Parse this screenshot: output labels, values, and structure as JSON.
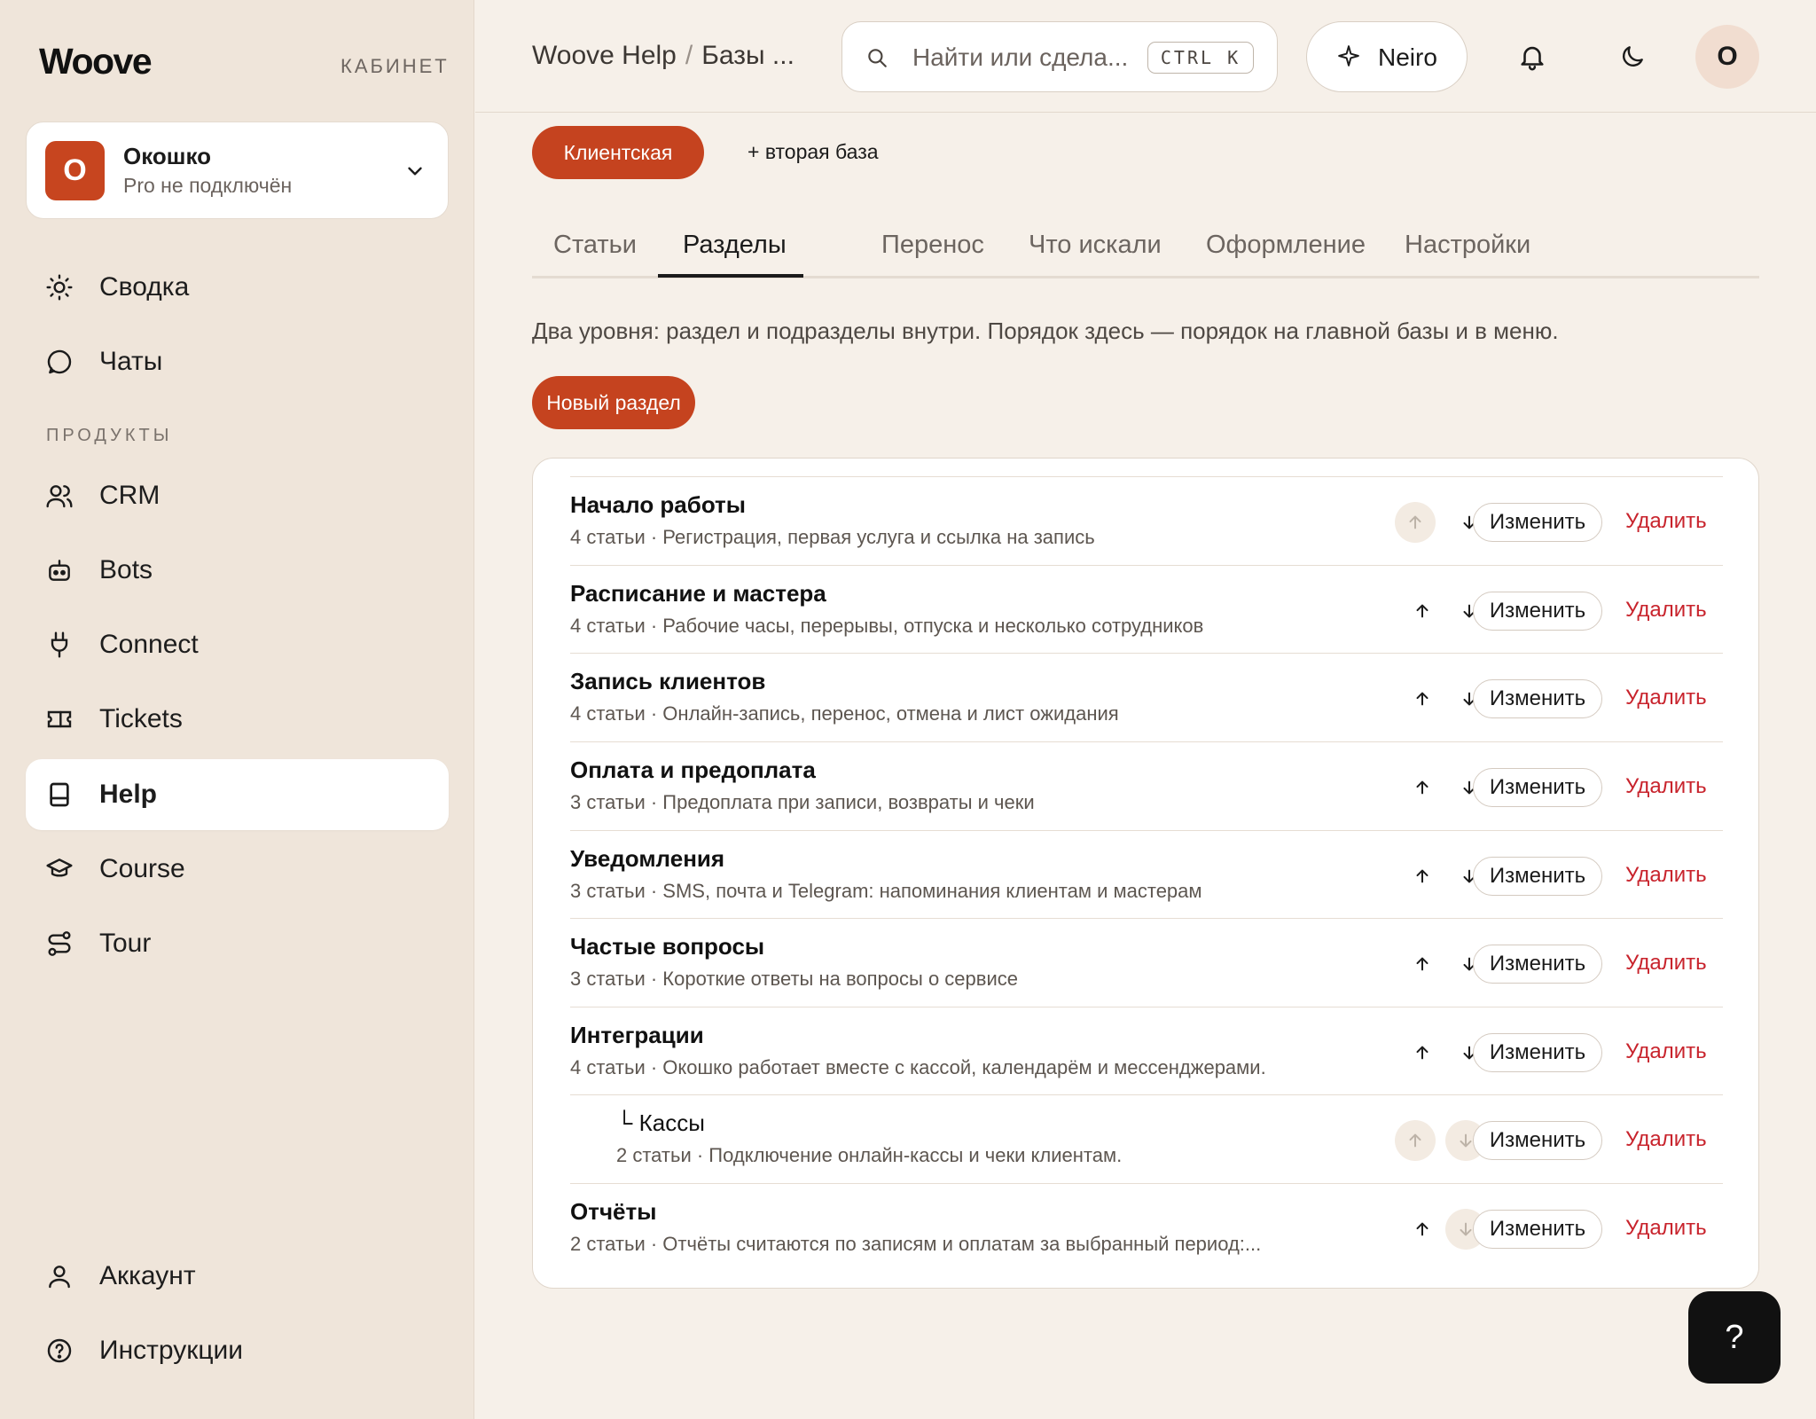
{
  "sidebar": {
    "logo": "Woove",
    "cabinet_label": "КАБИНЕТ",
    "org": {
      "initial": "О",
      "name": "Окошко",
      "plan": "Pro не подключён"
    },
    "nav_top": [
      {
        "label": "Сводка",
        "icon": "sun-icon"
      },
      {
        "label": "Чаты",
        "icon": "chat-icon"
      }
    ],
    "products_label": "ПРОДУКТЫ",
    "products": [
      {
        "label": "CRM",
        "icon": "users-icon"
      },
      {
        "label": "Bots",
        "icon": "bot-icon"
      },
      {
        "label": "Connect",
        "icon": "plug-icon"
      },
      {
        "label": "Tickets",
        "icon": "ticket-icon"
      },
      {
        "label": "Help",
        "icon": "book-icon",
        "active": true
      },
      {
        "label": "Course",
        "icon": "graduation-cap-icon"
      },
      {
        "label": "Tour",
        "icon": "route-icon"
      }
    ],
    "nav_bottom": [
      {
        "label": "Аккаунт",
        "icon": "user-icon"
      },
      {
        "label": "Инструкции",
        "icon": "help-circle-icon"
      }
    ]
  },
  "header": {
    "breadcrumb": [
      "Woove Help",
      "Базы ..."
    ],
    "search_placeholder": "Найти или сдела...",
    "search_shortcut": "CTRL K",
    "neiro_label": "Neiro",
    "avatar_initial": "О"
  },
  "bases": {
    "active": "Клиентская",
    "add_label": "+ вторая база"
  },
  "tabs": [
    "Статьи",
    "Разделы",
    "Перенос",
    "Что искали",
    "Оформление",
    "Настройки"
  ],
  "active_tab": "Разделы",
  "description": "Два уровня: раздел и подразделы внутри. Порядок здесь — порядок на главной базы и в меню.",
  "new_section_label": "Новый раздел",
  "sections": [
    {
      "title": "Начало работы",
      "meta": "4 статьи · Регистрация, первая услуга и ссылка на запись",
      "up": false,
      "down": true
    },
    {
      "title": "Расписание и мастера",
      "meta": "4 статьи · Рабочие часы, перерывы, отпуска и несколько сотрудников",
      "up": true,
      "down": true
    },
    {
      "title": "Запись клиентов",
      "meta": "4 статьи · Онлайн-запись, перенос, отмена и лист ожидания",
      "up": true,
      "down": true
    },
    {
      "title": "Оплата и предоплата",
      "meta": "3 статьи · Предоплата при записи, возвраты и чеки",
      "up": true,
      "down": true
    },
    {
      "title": "Уведомления",
      "meta": "3 статьи · SMS, почта и Telegram: напоминания клиентам и мастерам",
      "up": true,
      "down": true
    },
    {
      "title": "Частые вопросы",
      "meta": "3 статьи · Короткие ответы на вопросы о сервисе",
      "up": true,
      "down": true
    },
    {
      "title": "Интеграции",
      "meta": "4 статьи · Окошко работает вместе с кассой, календарём и мессенджерами.",
      "up": true,
      "down": true
    },
    {
      "title": "└ Кассы",
      "meta": "2 статьи · Подключение онлайн-кассы и чеки клиентам.",
      "up": false,
      "down": false,
      "sub": true
    },
    {
      "title": "Отчёты",
      "meta": "2 статьи · Отчёты считаются по записям и оплатам за выбранный период:...",
      "up": true,
      "down": false
    }
  ],
  "row_actions": {
    "edit": "Изменить",
    "delete": "Удалить"
  },
  "help_fab": "?",
  "colors": {
    "accent": "#c5431f",
    "danger": "#c8232c",
    "sidebar_bg": "#efe5da",
    "page_bg": "#f6f0e9"
  }
}
